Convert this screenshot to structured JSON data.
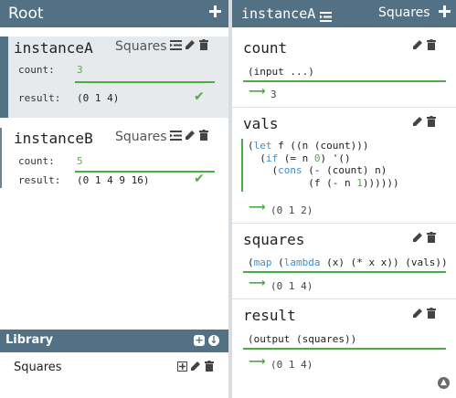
{
  "left": {
    "title": "Root",
    "instances": [
      {
        "name": "instanceA",
        "type": "Squares",
        "count_label": "count:",
        "count_value": "3",
        "result_label": "result:",
        "result_value": "(0 1 4)"
      },
      {
        "name": "instanceB",
        "type": "Squares",
        "count_label": "count:",
        "count_value": "5",
        "result_label": "result:",
        "result_value": "(0 1 4 9 16)"
      }
    ],
    "library": {
      "title": "Library",
      "items": [
        "Squares"
      ]
    }
  },
  "right": {
    "title": "instanceA",
    "type": "Squares",
    "cells": [
      {
        "name": "count",
        "code": "(input ...)",
        "output": "3"
      },
      {
        "name": "vals",
        "output": "(0 1 2)"
      },
      {
        "name": "squares",
        "output": "(0 1 4)"
      },
      {
        "name": "result",
        "code": "(output (squares))",
        "output": "(0 1 4)"
      }
    ]
  },
  "colors": {
    "header": "#537184",
    "accent_green": "#4aad44",
    "keyword_blue": "#3a8fd0",
    "selected_bg": "#e6eaed"
  },
  "icons": [
    "plus-icon",
    "list-icon",
    "pencil-icon",
    "trash-icon",
    "check-icon",
    "arrow-right-icon",
    "add-box-icon",
    "download-circle-icon",
    "scroll-up-icon"
  ]
}
